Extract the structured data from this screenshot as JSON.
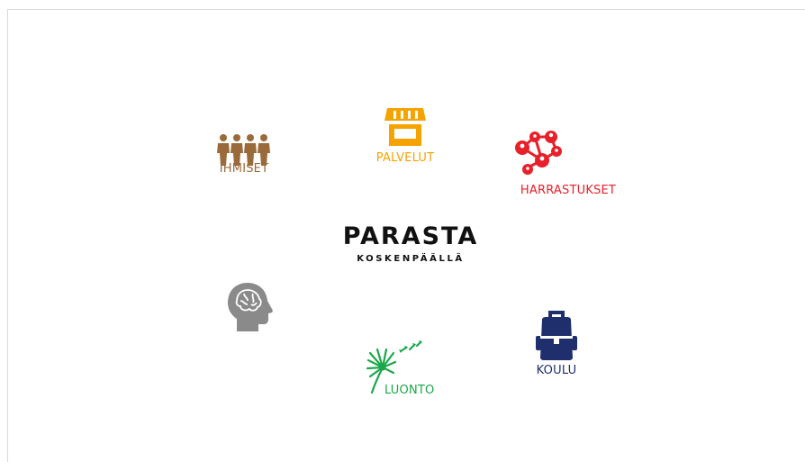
{
  "brand": {
    "title": "PARASTA",
    "subtitle": "KOSKENPÄÄLLÄ"
  },
  "tiles": {
    "ihmiset": {
      "label": "IHMISET",
      "icon": "people-group-icon",
      "color": "#9a6a3a"
    },
    "palvelut": {
      "label": "PALVELUT",
      "icon": "storefront-icon",
      "color": "#f5a300"
    },
    "harrastukset": {
      "label": "HARRASTUKSET",
      "icon": "network-people-icon",
      "color": "#e8202a"
    },
    "mind": {
      "label": "",
      "icon": "brain-head-icon",
      "color": "#8a8a8a"
    },
    "luonto": {
      "label": "LUONTO",
      "icon": "dandelion-icon",
      "color": "#1aa84a"
    },
    "koulu": {
      "label": "KOULU",
      "icon": "backpack-icon",
      "color": "#1f2f6e"
    }
  }
}
